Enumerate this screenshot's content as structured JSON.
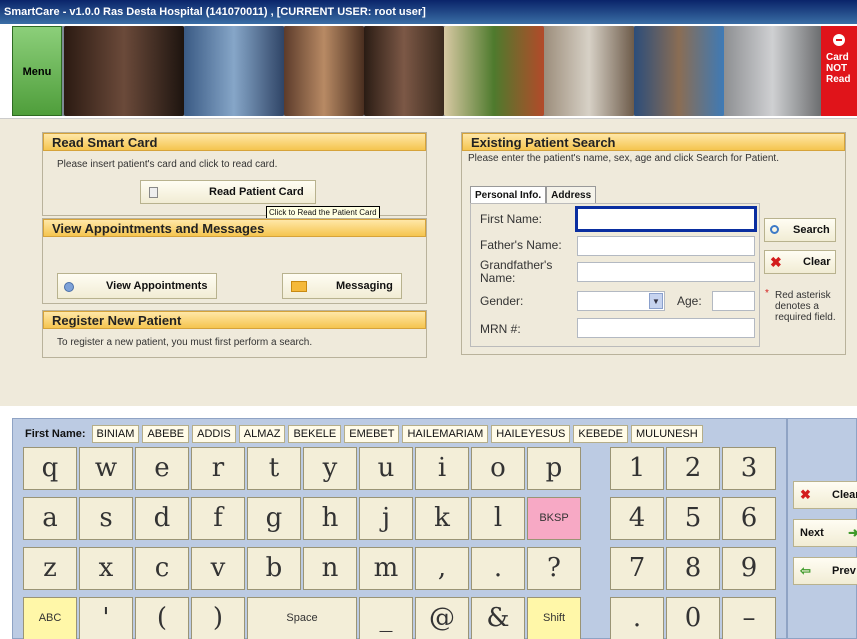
{
  "window": {
    "title": "SmartCare - v1.0.0 Ras Desta Hospital (141070011) , [CURRENT USER: root user]"
  },
  "banner": {
    "menu_label": "Menu",
    "card_status": [
      "Card",
      "NOT",
      "Read"
    ]
  },
  "read_card": {
    "title": "Read Smart Card",
    "instruction": "Please insert patient's card and click to read card.",
    "button": "Read Patient Card",
    "tooltip": "Click to Read the Patient Card"
  },
  "appointments": {
    "title": "View Appointments and Messages",
    "view_button": "View Appointments",
    "messaging_button": "Messaging"
  },
  "register": {
    "title": "Register New Patient",
    "text": "To register a new patient, you must first  perform a search."
  },
  "search": {
    "title": "Existing Patient Search",
    "instruction": "Please enter the patient's name, sex, age and click Search for Patient.",
    "tabs": [
      "Personal Info.",
      "Address"
    ],
    "fields": {
      "first_name": "First Name:",
      "fathers_name": "Father's Name:",
      "grandfathers_name_1": "Grandfather's",
      "grandfathers_name_2": "Name:",
      "gender": "Gender:",
      "age": "Age:",
      "mrn": "MRN #:"
    },
    "search_button": "Search",
    "clear_button": "Clear",
    "note": "Red asterisk denotes a required field."
  },
  "keyboard": {
    "field_label": "First Name:",
    "suggestions": [
      "BINIAM",
      "ABEBE",
      "ADDIS",
      "ALMAZ",
      "BEKELE",
      "EMEBET",
      "HAILEMARIAM",
      "HAILEYESUS",
      "KEBEDE",
      "MULUNESH"
    ],
    "rows": [
      [
        "q",
        "w",
        "e",
        "r",
        "t",
        "y",
        "u",
        "i",
        "o",
        "p"
      ],
      [
        "a",
        "s",
        "d",
        "f",
        "g",
        "h",
        "j",
        "k",
        "l",
        "BKSP"
      ],
      [
        "z",
        "x",
        "c",
        "v",
        "b",
        "n",
        "m",
        ",",
        ".",
        "?"
      ],
      [
        "ABC",
        "'",
        "(",
        ")",
        "Space",
        "_",
        "@",
        "&",
        "Shift"
      ]
    ],
    "numpad": [
      [
        "1",
        "2",
        "3"
      ],
      [
        "4",
        "5",
        "6"
      ],
      [
        "7",
        "8",
        "9"
      ],
      [
        ".",
        "0",
        "–"
      ]
    ],
    "side_buttons": [
      "Clear",
      "Next",
      "Prev"
    ]
  },
  "colors": {
    "accent_orange": "#f5c54f",
    "status_red": "#e0141a",
    "keyboard_bg": "#bccbe3"
  }
}
